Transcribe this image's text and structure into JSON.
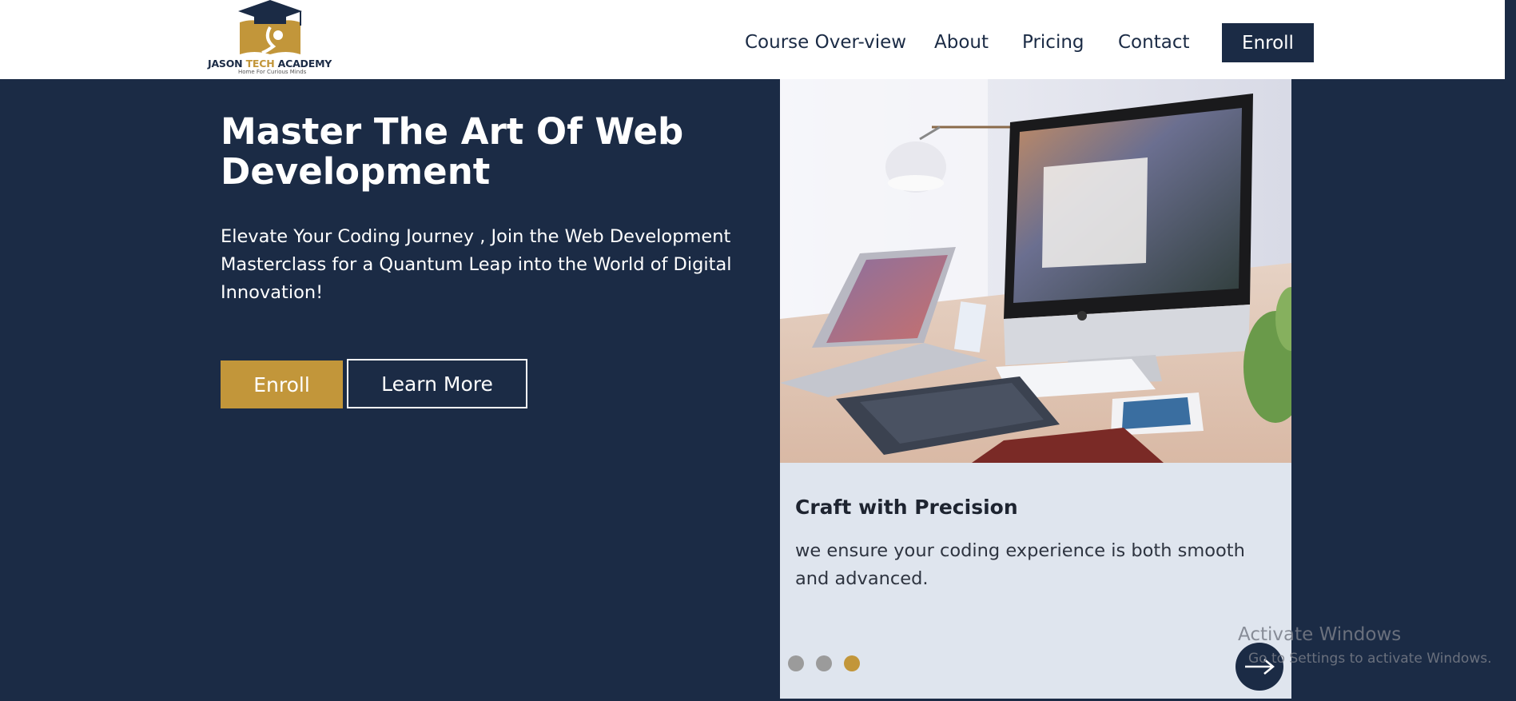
{
  "brand": {
    "name_part1": "JASON ",
    "name_part2": "TECH",
    "name_part3": " ACADEMY",
    "tagline": "Home For Curious Minds",
    "navy": "#1b2b45",
    "gold": "#c2963a",
    "logo_icon": "graduation-cap-book-icon"
  },
  "nav": {
    "items": [
      "Course Over-view",
      "About",
      "Pricing",
      "Contact"
    ],
    "cta": "Enroll"
  },
  "hero": {
    "title": "Master The Art Of Web Development",
    "subtitle": "Elevate Your Coding Journey , Join the Web Development Masterclass for a Quantum Leap into the World of Digital Innovation!",
    "primary_button": "Enroll",
    "secondary_button": "Learn More"
  },
  "card": {
    "title": "Craft with Precision",
    "text": "we ensure your coding experience is both smooth and advanced.",
    "slide_count": 3,
    "active_slide": 3,
    "next_icon": "arrow-right-icon"
  },
  "system": {
    "watermark_title": "Activate Windows",
    "watermark_text": "Go to Settings to activate Windows."
  }
}
